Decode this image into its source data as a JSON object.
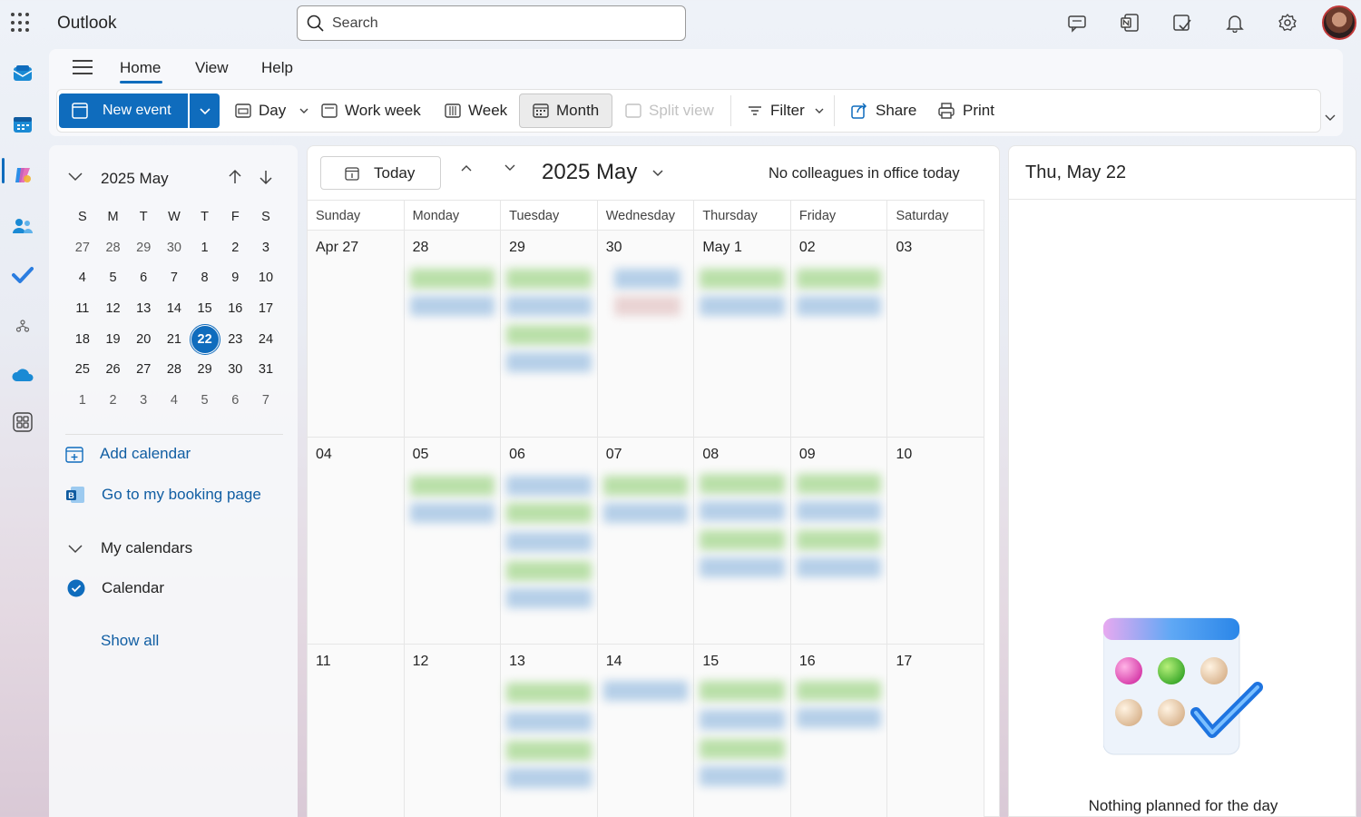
{
  "app": {
    "name": "Outlook"
  },
  "search": {
    "placeholder": "Search"
  },
  "ribbon": {
    "tabs": [
      "Home",
      "View",
      "Help"
    ],
    "new_event": "New event",
    "buttons": {
      "day": "Day",
      "work_week": "Work week",
      "week": "Week",
      "month": "Month",
      "split_view": "Split view",
      "filter": "Filter",
      "share": "Share",
      "print": "Print"
    }
  },
  "mini_calendar": {
    "title": "2025 May",
    "weekday_initials": [
      "S",
      "M",
      "T",
      "W",
      "T",
      "F",
      "S"
    ],
    "weeks": [
      [
        "27",
        "28",
        "29",
        "30",
        "1",
        "2",
        "3"
      ],
      [
        "4",
        "5",
        "6",
        "7",
        "8",
        "9",
        "10"
      ],
      [
        "11",
        "12",
        "13",
        "14",
        "15",
        "16",
        "17"
      ],
      [
        "18",
        "19",
        "20",
        "21",
        "22",
        "23",
        "24"
      ],
      [
        "25",
        "26",
        "27",
        "28",
        "29",
        "30",
        "31"
      ],
      [
        "1",
        "2",
        "3",
        "4",
        "5",
        "6",
        "7"
      ]
    ],
    "selected_day": "22"
  },
  "left_links": {
    "add_calendar": "Add calendar",
    "booking_page": "Go to my booking page",
    "my_calendars": "My calendars",
    "calendar": "Calendar",
    "show_all": "Show all"
  },
  "main": {
    "today": "Today",
    "month_title": "2025 May",
    "colleagues": "No colleagues in office today",
    "weekdays": [
      "Sunday",
      "Monday",
      "Tuesday",
      "Wednesday",
      "Thursday",
      "Friday",
      "Saturday"
    ],
    "weeks": [
      [
        "Apr 27",
        "28",
        "29",
        "30",
        "May 1",
        "02",
        "03"
      ],
      [
        "04",
        "05",
        "06",
        "07",
        "08",
        "09",
        "10"
      ],
      [
        "11",
        "12",
        "13",
        "14",
        "15",
        "16",
        "17"
      ]
    ]
  },
  "right_pane": {
    "title": "Thu, May 22",
    "empty_message": "Nothing planned for the day"
  },
  "colors": {
    "accent": "#0f6cbd",
    "event_green": "#b9dfa8",
    "event_blue": "#b5cfe8"
  }
}
